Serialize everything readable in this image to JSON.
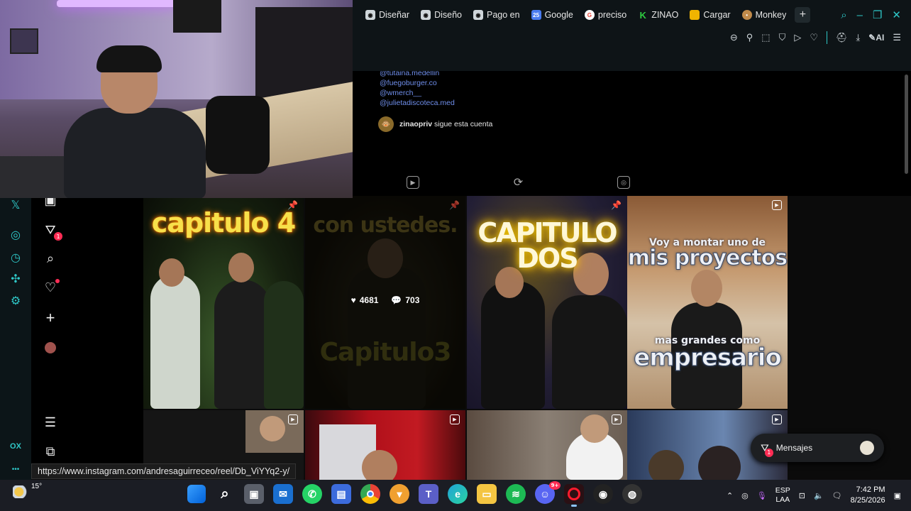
{
  "browser": {
    "tabs": [
      {
        "label": "Diseñar",
        "icon": "opera-tab-icon",
        "color": "#cfd6da"
      },
      {
        "label": "Diseño",
        "icon": "opera-tab-icon",
        "color": "#cfd6da"
      },
      {
        "label": "Pago en",
        "icon": "opera-tab-icon",
        "color": "#cfd6da"
      },
      {
        "label": "Google",
        "icon": "calendar-icon",
        "color": "#4a7cf0"
      },
      {
        "label": "preciso",
        "icon": "google-icon",
        "color": "#ffffff"
      },
      {
        "label": "ZINAO",
        "icon": "zinao-icon",
        "color": "#2ecc40"
      },
      {
        "label": "Cargar",
        "icon": "folder-icon",
        "color": "#f0b400"
      },
      {
        "label": "Monkey",
        "icon": "monkey-icon",
        "color": "#c08a4a"
      }
    ],
    "toolbar_ai": "AI"
  },
  "profile": {
    "mentions": [
      "@tutaina.medellin",
      "@fuegoburger.co",
      "@wmerch__",
      "@julietadiscoteca.med"
    ],
    "follower_name": "zinaopriv",
    "follows_text": "sigue esta cuenta"
  },
  "posts": {
    "p1_title": "capitulo 4",
    "p2_title": "con ustedes.",
    "p2_subtitle": "Capitulo3",
    "p2_likes": "4681",
    "p2_comments": "703",
    "p3_title_1": "CAPITULO",
    "p3_title_2": "DOS",
    "p4_title_1": "Voy a montar uno de",
    "p4_title_2": "mis proyectos",
    "p4_title_3": "mas grandes como",
    "p4_title_4": "empresario"
  },
  "sidebar": {
    "messages_badge": "1"
  },
  "messages": {
    "label": "Mensajes",
    "badge": "1"
  },
  "status_url": "https://www.instagram.com/andresaguirreceo/reel/Db_ViYYq2-y/",
  "opera": {
    "label_ox": "OX",
    "more": "•••"
  },
  "taskbar": {
    "weather_temp": "15°",
    "lang_1": "ESP",
    "lang_2": "LAA",
    "time": "7:42 PM",
    "date": "8/25/2026",
    "discord_badge": "9+"
  },
  "colors": {
    "accent_teal": "#2ec7c7",
    "badge_red": "#ff2d55",
    "link_blue": "#6f8eea"
  }
}
